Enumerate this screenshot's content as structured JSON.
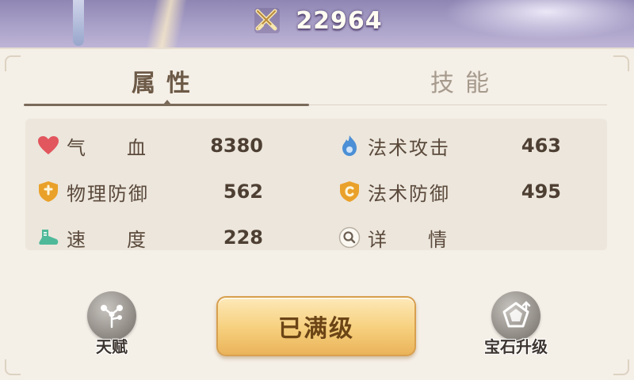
{
  "header": {
    "power_value": "22964",
    "power_icon": "crossed-swords-icon"
  },
  "tabs": [
    {
      "label": "属性",
      "active": true
    },
    {
      "label": "技能",
      "active": false
    }
  ],
  "stats": {
    "hp": {
      "label": "气血",
      "label_chars": [
        "气",
        "血"
      ],
      "value": "8380",
      "icon": "heart-icon",
      "color": "#e2565e"
    },
    "phys_def": {
      "label": "物理防御",
      "value": "562",
      "icon": "shield-icon",
      "color": "#eaa12a"
    },
    "speed": {
      "label": "速度",
      "label_chars": [
        "速",
        "度"
      ],
      "value": "228",
      "icon": "boot-icon",
      "color": "#4fb99a"
    },
    "magic_atk": {
      "label": "法术攻击",
      "value": "463",
      "icon": "flame-icon",
      "color": "#4b8fd6"
    },
    "magic_def": {
      "label": "法术防御",
      "value": "495",
      "icon": "magic-shield-icon",
      "color": "#eaa12a"
    },
    "details": {
      "label": "详情",
      "label_chars": [
        "详",
        "情"
      ],
      "icon": "magnifier-icon"
    }
  },
  "actions": {
    "talent_label": "天赋",
    "max_level_label": "已满级",
    "gem_upgrade_label": "宝石升级"
  }
}
